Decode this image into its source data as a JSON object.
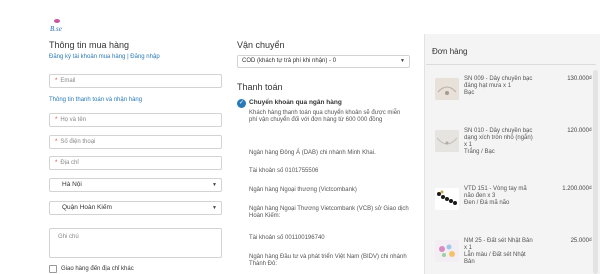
{
  "brand": {
    "logo_text": "B.se"
  },
  "checkout": {
    "title": "Thông tin mua hàng",
    "register_link": "Đăng ký tài khoản mua hàng",
    "separator": "|",
    "login_link": "Đăng nhập",
    "email_placeholder": "Email",
    "info_link": "Thông tin thanh toán và nhận hàng",
    "name_placeholder": "Họ và tên",
    "phone_placeholder": "Số điện thoại",
    "address_placeholder": "Địa chỉ",
    "city_value": "Hà Nội",
    "district_value": "Quận Hoàn Kiếm",
    "note_placeholder": "Ghi chú",
    "alt_address_label": "Giao hàng đến địa chỉ khác",
    "required_mark": "*"
  },
  "shipping": {
    "title": "Vận chuyển",
    "selected": "COD (khách tự trả phí khi nhận) - 0"
  },
  "payment": {
    "title": "Thanh toán",
    "option_name": "Chuyển khoản qua ngân hàng",
    "description": "Khách hàng thanh toán qua chuyển khoản sẽ được miễn phí vận chuyển đối với đơn hàng từ 600 000 đồng",
    "bank1": "Ngân hàng Đông Á (DAB) chi nhánh Minh Khai.",
    "account1": "Tài khoản số 0101755506",
    "bank2": "Ngân hàng Ngoại thương (Victcombank)",
    "bank2_detail": "Ngân hàng Ngoại Thương Vietcombank (VCB) sở Giao dịch Hoàn Kiếm:",
    "account2": "Tài khoản số 001100196740",
    "bank3": "Ngân hàng Đầu tư và phát triển Việt Nam (BIDV) chi nhánh Thành Đô:"
  },
  "order": {
    "title": "Đơn hàng",
    "items": [
      {
        "name": "SN 009 - Dây chuyền bạc đáng hạt mưa x 1",
        "variant": "Bạc",
        "price": "130.000₫"
      },
      {
        "name": "SN 010 - Dây chuyền bạc dạng xích tròn nhỏ (ngắn) x 1",
        "variant": "Trắng / Bạc",
        "price": "120.000₫"
      },
      {
        "name": "VTD 151 - Vòng tay mã não đen x 3",
        "variant": "Đen / Đá mã não",
        "price": "1.200.000₫"
      },
      {
        "name": "NM 25 - Đất sét Nhật Bản x 1",
        "variant": "Lẵn màu / Đất sét Nhật Bản",
        "price": "25.000₫"
      }
    ]
  },
  "icons": {
    "select_arrow": "▼",
    "check": "✓"
  },
  "colors": {
    "link": "#2a7ab8",
    "required": "#e0393e",
    "sidebar_bg": "#f4f4f4"
  }
}
